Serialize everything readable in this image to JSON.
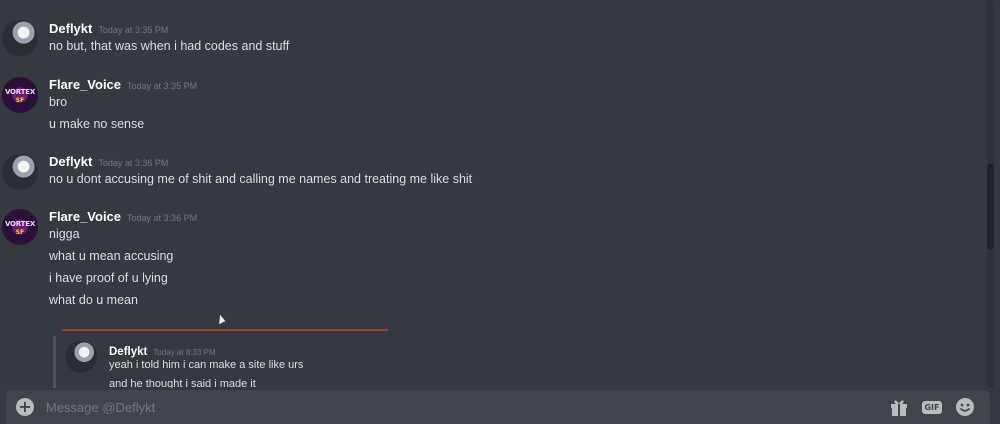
{
  "messages": [
    {
      "username": "Deflykt",
      "timestamp": "Today at 3:35 PM",
      "avatar": "deflykt-avatar",
      "lines": [
        "no but, that was when i had codes and stuff"
      ]
    },
    {
      "username": "Flare_Voice",
      "timestamp": "Today at 3:35 PM",
      "avatar": "flare-voice-avatar",
      "avatar_text": [
        "VORTEX",
        "SF"
      ],
      "lines": [
        "bro",
        "u make no sense"
      ]
    },
    {
      "username": "Deflykt",
      "timestamp": "Today at 3:36 PM",
      "avatar": "deflykt-avatar",
      "lines": [
        "no u dont accusing me of shit and calling me names and treating me like shit"
      ]
    },
    {
      "username": "Flare_Voice",
      "timestamp": "Today at 3:36 PM",
      "avatar": "flare-voice-avatar",
      "avatar_text": [
        "VORTEX",
        "SF"
      ],
      "lines": [
        "nigga",
        "what u mean accusing",
        "i have proof of u lying",
        "what do u mean"
      ]
    }
  ],
  "embed": {
    "username": "Deflykt",
    "timestamp": "Today at 8:33 PM",
    "lines": [
      "yeah i told him i can make a site like urs",
      "and he thought i said i made it"
    ]
  },
  "composer": {
    "placeholder": "Message @Deflykt",
    "gif_label": "GIF"
  },
  "icons": {
    "add": "plus-circle-icon",
    "gift": "gift-icon",
    "gif": "gif-icon",
    "emoji": "emoji-icon"
  },
  "colors": {
    "background": "#36393f",
    "composer": "#40444b",
    "username": "#ffffff",
    "timestamp": "#72767d",
    "divider": "#a33a3a"
  }
}
